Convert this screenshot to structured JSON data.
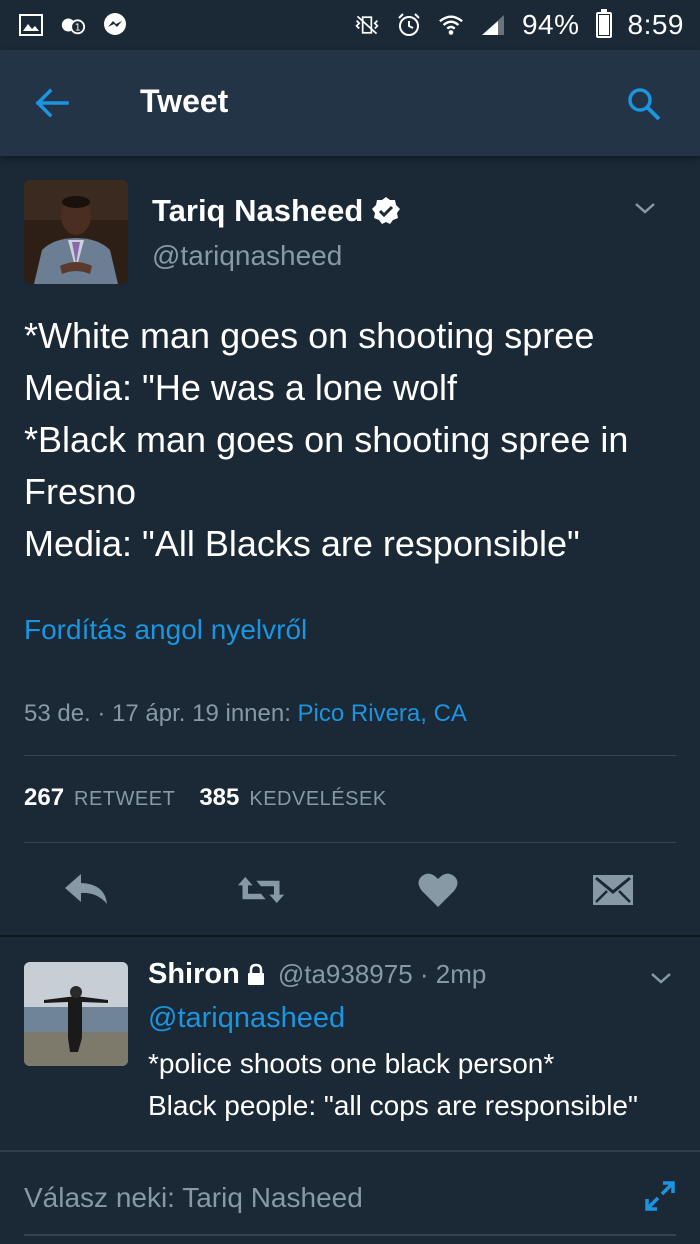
{
  "status_bar": {
    "battery_percent": "94%",
    "time": "8:59",
    "battery_level": 0.94
  },
  "app_bar": {
    "title": "Tweet"
  },
  "tweet": {
    "author_name": "Tariq Nasheed",
    "author_handle": "@tariqnasheed",
    "text": "*White man goes on shooting spree\nMedia: \"He was a lone wolf\n*Black man goes on shooting spree in Fresno\nMedia: \"All Blacks are responsible\"",
    "translate_link": "Fordítás angol nyelvről",
    "meta_time": "53 de. · 17 ápr. 19 innen: ",
    "meta_location": "Pico Rivera, CA",
    "retweet_count": "267",
    "retweet_label": "RETWEET",
    "like_count": "385",
    "like_label": "KEDVELÉSEK"
  },
  "reply": {
    "author_name": "Shiron",
    "author_handle": "@ta938975 · 2mp",
    "mention": "@tariqnasheed",
    "text": "*police shoots one black person*\nBlack people: \"all cops are responsible\""
  },
  "composer": {
    "placeholder": "Válasz neki: Tariq Nasheed"
  },
  "colors": {
    "background": "#1b2836",
    "app_bar": "#243447",
    "accent": "#1b95e0",
    "muted": "#8899a6"
  }
}
